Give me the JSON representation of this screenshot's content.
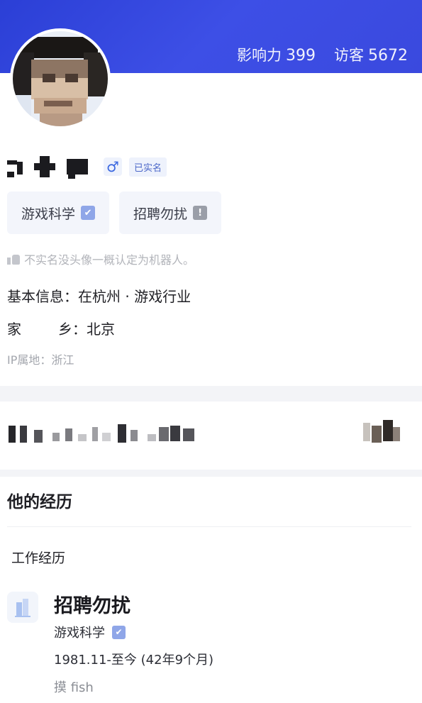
{
  "header": {
    "influence_label": "影响力",
    "influence_value": "399",
    "visitors_label": "访客",
    "visitors_value": "5672"
  },
  "profile": {
    "gender_symbol": "♂",
    "verified_badge": "已实名",
    "tags": [
      {
        "label": "游戏科学",
        "mark": "✔"
      },
      {
        "label": "招聘勿扰",
        "mark": "!"
      }
    ],
    "note": "不实名没头像一概认定为机器人。",
    "basic_info": "基本信息：在杭州 · 游戏行业",
    "hometown_key_1": "家",
    "hometown_key_2": "乡：北京",
    "ip_location": "IP属地：浙江"
  },
  "experience": {
    "section_title": "他的经历",
    "work_title": "工作经历",
    "job": {
      "title": "招聘勿扰",
      "company": "游戏科学",
      "company_mark": "✔",
      "period": "1981.11-至今 (42年9个月)",
      "description": "摸 fish"
    }
  },
  "colors": {
    "header_blue": "#3a49de",
    "accent_blue": "#3b68e0",
    "divider": "#f3f4f7"
  }
}
